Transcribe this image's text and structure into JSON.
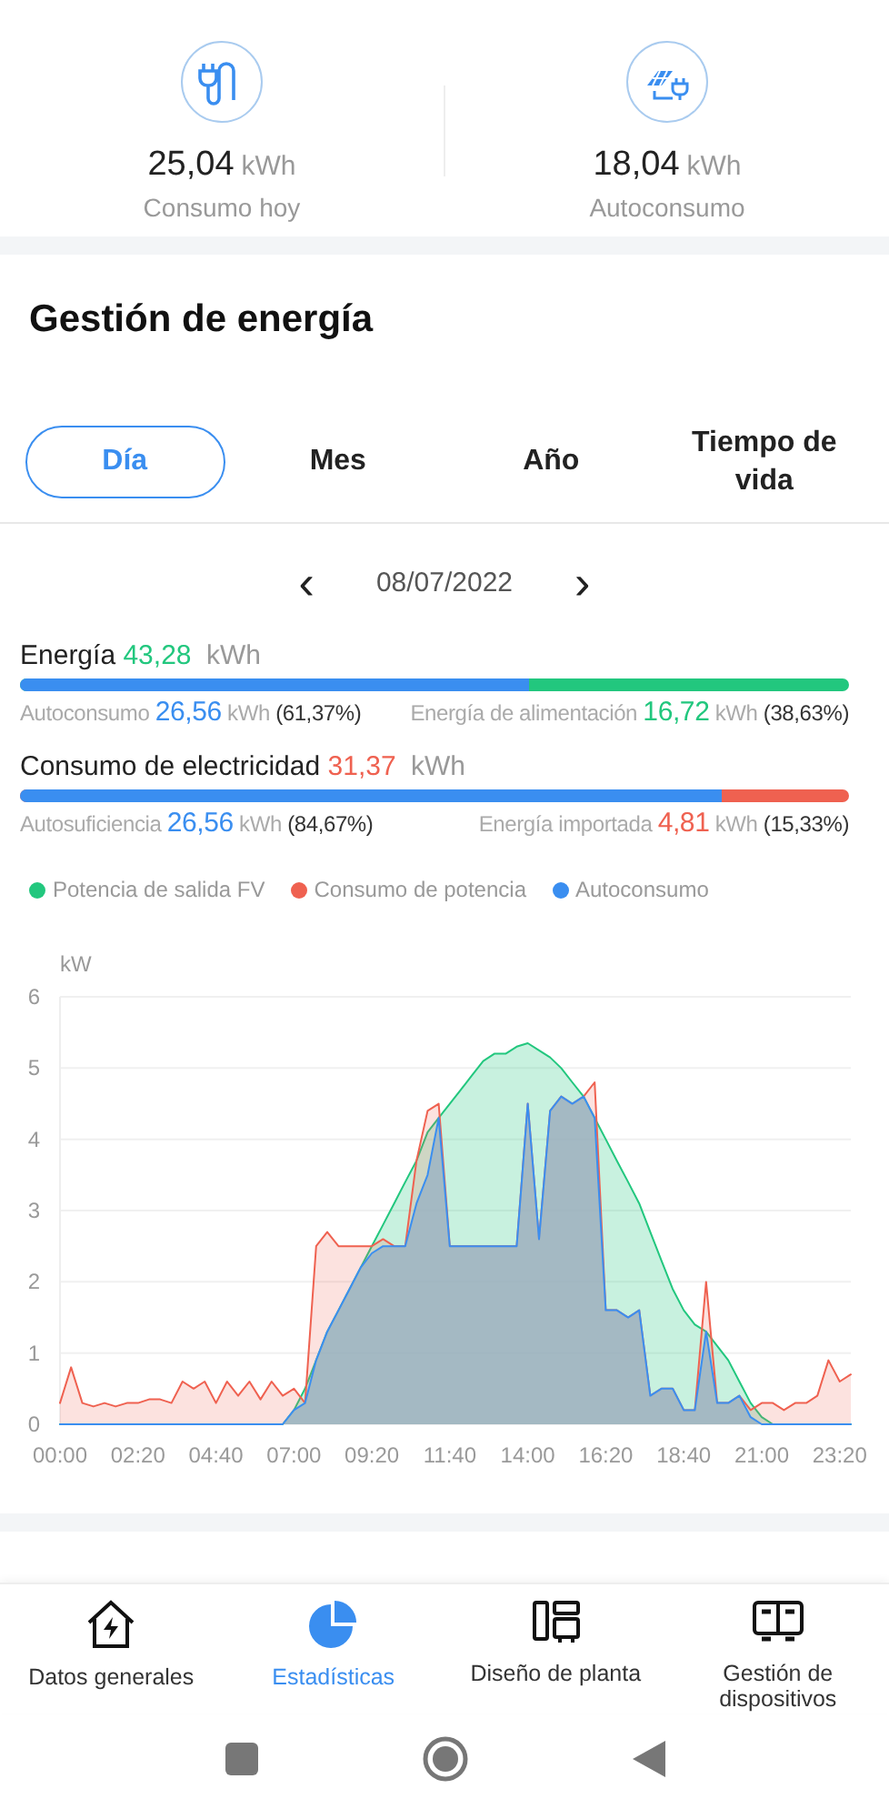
{
  "summary": [
    {
      "kind": "plug",
      "value": "25,04",
      "unit": "kWh",
      "label": "Consumo hoy"
    },
    {
      "kind": "solar",
      "value": "18,04",
      "unit": "kWh",
      "label": "Autoconsumo"
    }
  ],
  "section_title": "Gestión de energía",
  "tabs": [
    {
      "label": "Día",
      "selected": true
    },
    {
      "label": "Mes",
      "selected": false
    },
    {
      "label": "Año",
      "selected": false
    },
    {
      "label": "Tiempo de vida",
      "selected": false
    }
  ],
  "date_nav": {
    "prev": "‹",
    "date": "08/07/2022",
    "next": "›"
  },
  "energy": {
    "label": "Energía",
    "value": "43,28",
    "unit": "kWh",
    "level": 0.6137,
    "left": {
      "label": "Autoconsumo",
      "value": "26,56",
      "unit": "kWh",
      "percent": "(61,37%)"
    },
    "right": {
      "label": "Energía de alimentación",
      "value": "16,72",
      "unit": "kWh",
      "percent": "(38,63%)"
    }
  },
  "consumption": {
    "label": "Consumo de electricidad",
    "value": "31,37",
    "unit": "kWh",
    "level": 0.8467,
    "left": {
      "label": "Autosuficiencia",
      "value": "26,56",
      "unit": "kWh",
      "percent": "(84,67%)"
    },
    "right": {
      "label": "Energía importada",
      "value": "4,81",
      "unit": "kWh",
      "percent": "(15,33%)"
    }
  },
  "chart_data": {
    "type": "area",
    "ylabel": "kW",
    "ylim": [
      0,
      6
    ],
    "yticks": [
      0,
      1,
      2,
      3,
      4,
      5,
      6
    ],
    "grid": true,
    "xlim": [
      0,
      1420
    ],
    "xticks": [
      {
        "value": 0,
        "label": "00:00"
      },
      {
        "value": 140,
        "label": "02:20"
      },
      {
        "value": 280,
        "label": "04:40"
      },
      {
        "value": 420,
        "label": "07:00"
      },
      {
        "value": 560,
        "label": "09:20"
      },
      {
        "value": 700,
        "label": "11:40"
      },
      {
        "value": 840,
        "label": "14:00"
      },
      {
        "value": 980,
        "label": "16:20"
      },
      {
        "value": 1120,
        "label": "18:40"
      },
      {
        "value": 1260,
        "label": "21:00"
      },
      {
        "value": 1400,
        "label": "23:20"
      }
    ],
    "x": [
      0,
      20,
      40,
      60,
      80,
      100,
      120,
      140,
      160,
      180,
      200,
      220,
      240,
      260,
      280,
      300,
      320,
      340,
      360,
      380,
      400,
      420,
      440,
      460,
      480,
      500,
      520,
      540,
      560,
      580,
      600,
      620,
      640,
      660,
      680,
      700,
      720,
      740,
      760,
      780,
      800,
      820,
      840,
      860,
      880,
      900,
      920,
      940,
      960,
      980,
      1000,
      1020,
      1040,
      1060,
      1080,
      1100,
      1120,
      1140,
      1160,
      1180,
      1200,
      1220,
      1240,
      1260,
      1280,
      1300,
      1320,
      1340,
      1360,
      1380,
      1400,
      1420
    ],
    "series": [
      {
        "name": "Potencia de salida FV",
        "color": "#22c77e",
        "values": [
          0,
          0,
          0,
          0,
          0,
          0,
          0,
          0,
          0,
          0,
          0,
          0,
          0,
          0,
          0,
          0,
          0,
          0,
          0,
          0,
          0,
          0.2,
          0.5,
          0.9,
          1.3,
          1.6,
          1.9,
          2.2,
          2.5,
          2.8,
          3.1,
          3.4,
          3.7,
          4.1,
          4.3,
          4.5,
          4.7,
          4.9,
          5.1,
          5.2,
          5.2,
          5.3,
          5.35,
          5.25,
          5.15,
          5.0,
          4.8,
          4.6,
          4.3,
          4.0,
          3.7,
          3.4,
          3.1,
          2.7,
          2.3,
          1.9,
          1.6,
          1.4,
          1.3,
          1.1,
          0.9,
          0.6,
          0.3,
          0.1,
          0,
          0,
          0,
          0,
          0,
          0,
          0,
          0
        ]
      },
      {
        "name": "Consumo de potencia",
        "color": "#ef6150",
        "values": [
          0.3,
          0.8,
          0.3,
          0.25,
          0.3,
          0.25,
          0.3,
          0.3,
          0.35,
          0.35,
          0.3,
          0.6,
          0.5,
          0.6,
          0.3,
          0.6,
          0.4,
          0.6,
          0.35,
          0.6,
          0.4,
          0.5,
          0.3,
          2.5,
          2.7,
          2.5,
          2.5,
          2.5,
          2.5,
          2.6,
          2.5,
          2.5,
          3.7,
          4.4,
          4.5,
          2.5,
          2.5,
          2.5,
          2.5,
          2.5,
          2.5,
          2.5,
          4.5,
          2.6,
          4.4,
          4.6,
          4.5,
          4.6,
          4.8,
          1.6,
          1.6,
          1.5,
          1.6,
          0.4,
          0.5,
          0.5,
          0.2,
          0.2,
          2.0,
          0.3,
          0.3,
          0.4,
          0.2,
          0.3,
          0.3,
          0.2,
          0.3,
          0.3,
          0.4,
          0.9,
          0.6,
          0.7
        ]
      },
      {
        "name": "Autoconsumo",
        "color": "#3a8ef0",
        "values": [
          0,
          0,
          0,
          0,
          0,
          0,
          0,
          0,
          0,
          0,
          0,
          0,
          0,
          0,
          0,
          0,
          0,
          0,
          0,
          0,
          0,
          0.2,
          0.3,
          0.9,
          1.3,
          1.6,
          1.9,
          2.2,
          2.4,
          2.5,
          2.5,
          2.5,
          3.1,
          3.5,
          4.3,
          2.5,
          2.5,
          2.5,
          2.5,
          2.5,
          2.5,
          2.5,
          4.5,
          2.6,
          4.4,
          4.6,
          4.5,
          4.6,
          4.3,
          1.6,
          1.6,
          1.5,
          1.6,
          0.4,
          0.5,
          0.5,
          0.2,
          0.2,
          1.3,
          0.3,
          0.3,
          0.4,
          0.1,
          0,
          0,
          0,
          0,
          0,
          0,
          0,
          0,
          0
        ]
      }
    ]
  },
  "bottom_nav": [
    {
      "kind": "home",
      "label": "Datos generales",
      "selected": false
    },
    {
      "kind": "pie",
      "label": "Estadísticas",
      "selected": true
    },
    {
      "kind": "layout",
      "label": "Diseño de planta",
      "selected": false
    },
    {
      "kind": "device",
      "label": "Gestión de dispositivos",
      "selected": false
    }
  ]
}
